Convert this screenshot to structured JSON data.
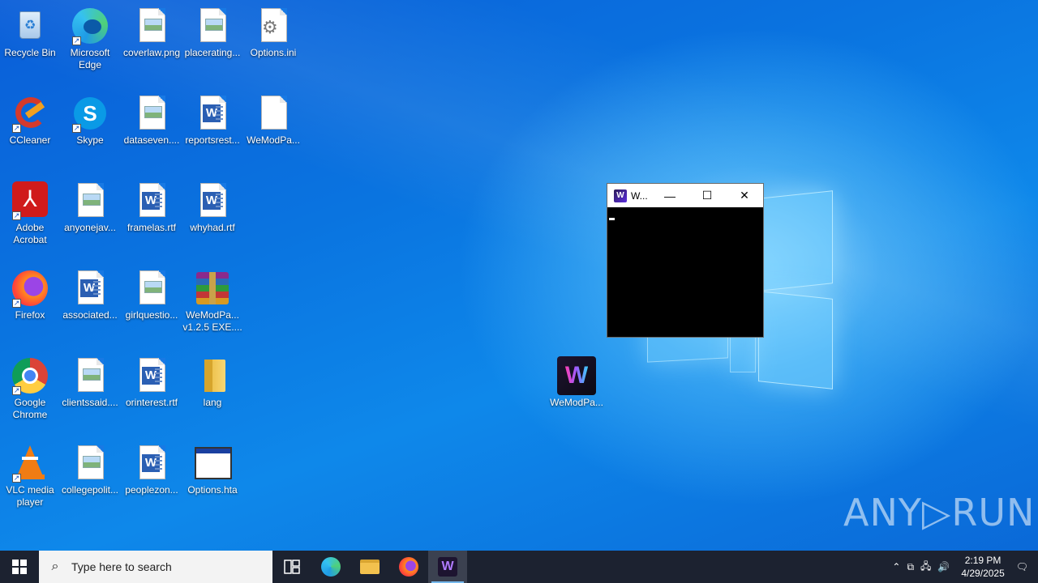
{
  "desktop": {
    "icons": [
      {
        "label": "Recycle Bin"
      },
      {
        "label": "Microsoft Edge"
      },
      {
        "label": "coverlaw.png"
      },
      {
        "label": "placerating..."
      },
      {
        "label": "Options.ini"
      },
      {
        "label": "CCleaner"
      },
      {
        "label": "Skype"
      },
      {
        "label": "dataseven...."
      },
      {
        "label": "reportsrest..."
      },
      {
        "label": "WeModPa..."
      },
      {
        "label": "Adobe Acrobat"
      },
      {
        "label": "anyonejav..."
      },
      {
        "label": "framelas.rtf"
      },
      {
        "label": "whyhad.rtf"
      },
      {
        "label": "Firefox"
      },
      {
        "label": "associated..."
      },
      {
        "label": "girlquestio..."
      },
      {
        "label": "WeModPa... v1.2.5 EXE...."
      },
      {
        "label": "Google Chrome"
      },
      {
        "label": "clientssaid...."
      },
      {
        "label": "orinterest.rtf"
      },
      {
        "label": "lang"
      },
      {
        "label": "VLC media player"
      },
      {
        "label": "collegepolit..."
      },
      {
        "label": "peoplezon..."
      },
      {
        "label": "Options.hta"
      },
      {
        "label": "WeModPa..."
      }
    ]
  },
  "console": {
    "title": "W...",
    "minimize_glyph": "—",
    "maximize_glyph": "☐",
    "close_glyph": "✕"
  },
  "taskbar": {
    "search_placeholder": "Type here to search",
    "time": "2:19 PM",
    "date": "4/29/2025"
  },
  "watermark": "ANY▷RUN",
  "colors": {
    "taskbar": "#1c2230",
    "desktop_blue": "#0a74e0",
    "console_bg": "#000000"
  }
}
